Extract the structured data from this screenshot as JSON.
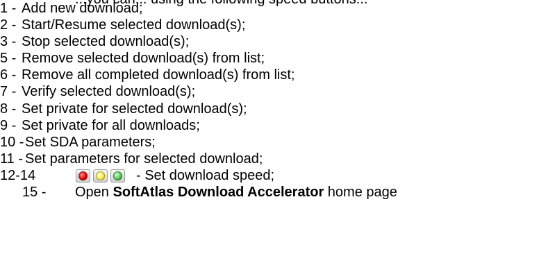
{
  "clipped_top_text": "...you can... using the following speed buttons...",
  "items": [
    {
      "num": "1 -",
      "text": "Add new download;"
    },
    {
      "num": "2 -",
      "text": "Start/Resume selected download(s);"
    },
    {
      "num": "3 -",
      "text": "Stop selected download(s);"
    },
    {
      "num": "5 -",
      "text": "Remove selected download(s) from list;"
    },
    {
      "num": "6 -",
      "text": "Remove all completed download(s) from list;"
    },
    {
      "num": "7 -",
      "text": "Verify selected download(s);"
    },
    {
      "num": "8 -",
      "text": "Set private for selected download(s);"
    },
    {
      "num": "9 -",
      "text": "Set private for all downloads;"
    },
    {
      "num": "10 -",
      "text": "Set SDA parameters;"
    },
    {
      "num": "11 -",
      "text": "Set parameters for selected download;"
    }
  ],
  "speed": {
    "num": "12-14",
    "text": "- Set download speed;",
    "icons": [
      "red-speed-light-icon",
      "yellow-speed-light-icon",
      "green-speed-light-icon"
    ]
  },
  "home": {
    "num": "15 -",
    "prefix": "Open ",
    "brand": "SoftAtlas Download Accelerator",
    "suffix": " home page"
  }
}
